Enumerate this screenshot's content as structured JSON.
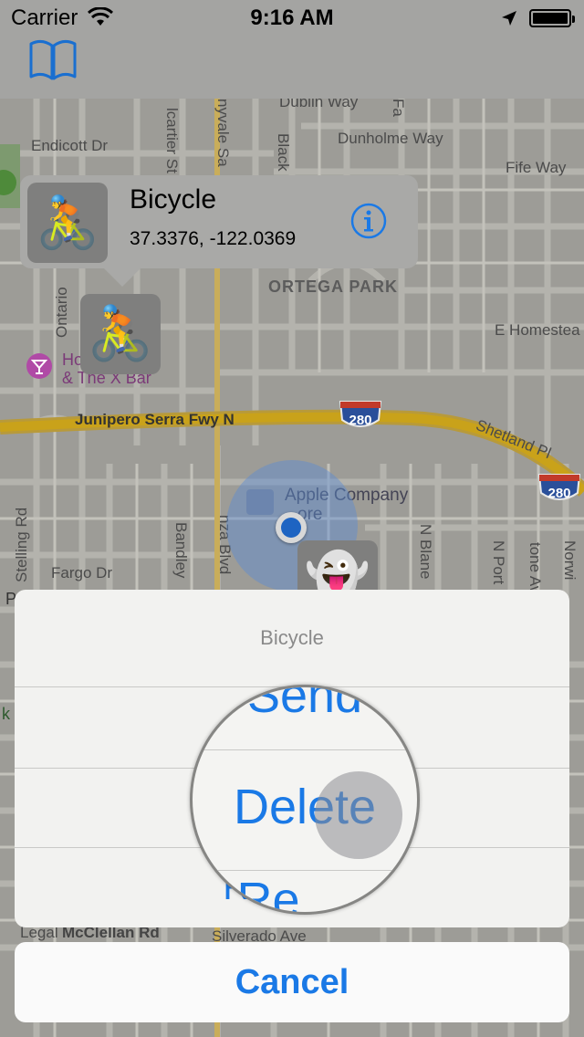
{
  "status_bar": {
    "carrier": "Carrier",
    "time": "9:16 AM",
    "icons": [
      "wifi-icon",
      "location-arrow-icon",
      "battery-icon"
    ]
  },
  "nav_bar": {
    "left_icon": "book-icon"
  },
  "map": {
    "streets": {
      "dublin_way": "Dublin Way",
      "endicott_dr": "Endicott Dr",
      "dunholme_way": "Dunholme Way",
      "fife_way": "Fife Way",
      "ortega_park": "ORTEGA PARK",
      "e_homestead": "E Homestea",
      "junipero_serra": "Junipero Serra Fwy N",
      "shetland_pl": "Shetland Pl",
      "fargo_dr": "Fargo Dr",
      "stelling_rd": "Stelling Rd",
      "bandley": "Bandley",
      "anza_blvd": "nza Blvd",
      "n_blane": "N Blane",
      "n_port": "N Port",
      "tone_ave": "tone Ave",
      "norwi": "Norwi",
      "nyvale_sa": "nyvale Sa",
      "black": "Black",
      "lcartier_st": "lcartier St",
      "ontario": "Ontario",
      "mcclellan_rd": "McClellan Rd",
      "legal": "Legal",
      "silverado_ave": "Silverado Ave",
      "pa": "Pa",
      "fa": "Fa"
    },
    "poi": {
      "bowl_line1": "Ho          Bowl",
      "bowl_line2": "& The X Bar",
      "apple_line1": "Apple Company",
      "apple_line2": "ore"
    },
    "highway_shields": [
      "280",
      "280"
    ],
    "pins": [
      "bicycle-emoji",
      "ghost-emoji"
    ]
  },
  "callout": {
    "title": "Bicycle",
    "coordinates": "37.3376, -122.0369",
    "accent_color": "#1a79e6"
  },
  "action_sheet": {
    "title": "Bicycle",
    "buttons": [
      "Send",
      "Delete",
      "Rename"
    ],
    "cancel_label": "Cancel"
  },
  "magnifier": {
    "text_above": "Send",
    "text_center": "Delete",
    "text_below": "Re"
  },
  "colors": {
    "accent": "#1a79e6",
    "highway": "#c9a21a"
  }
}
